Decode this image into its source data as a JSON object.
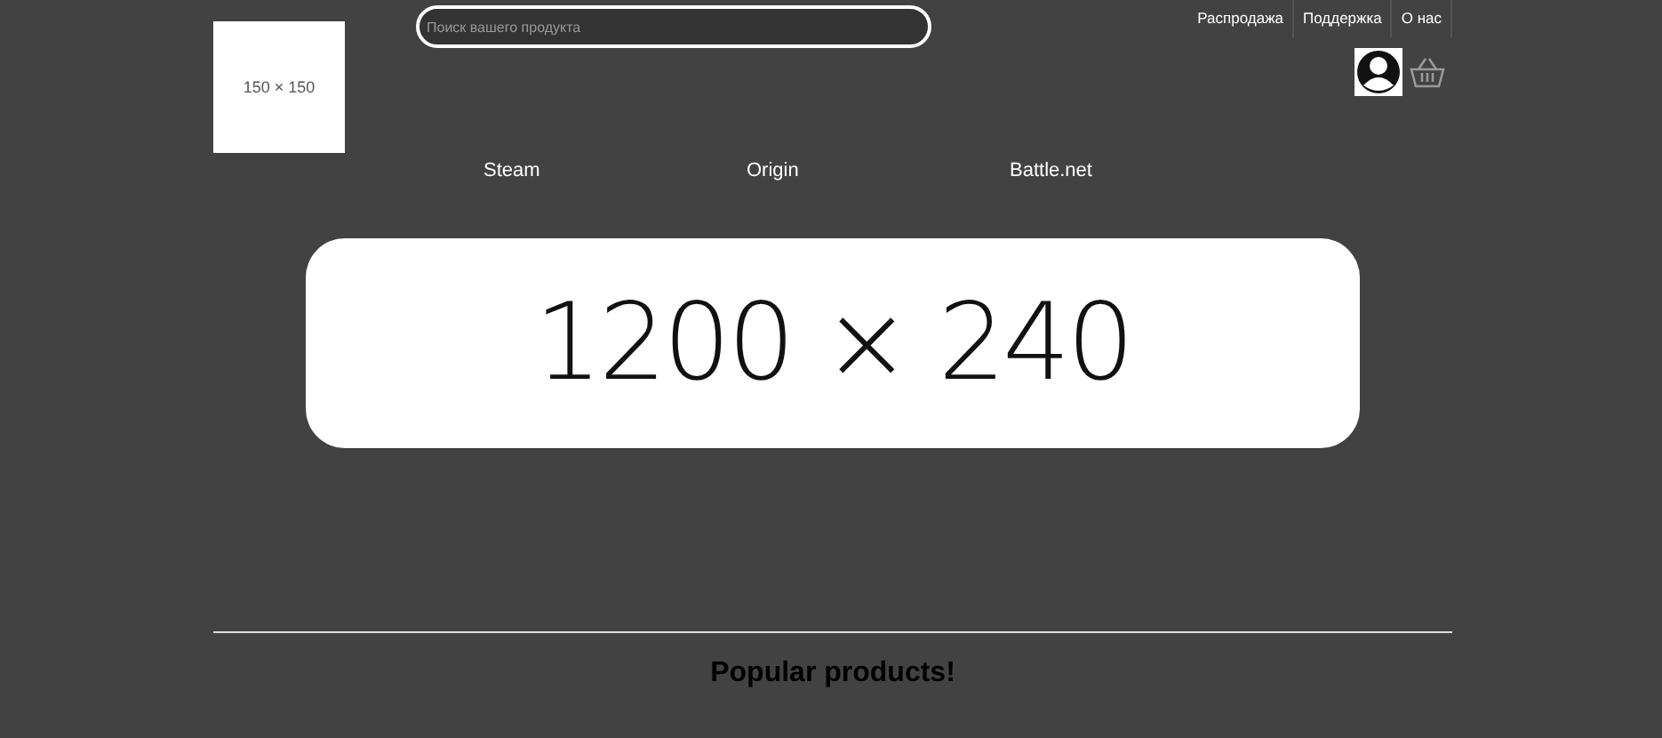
{
  "logo": {
    "text": "150 × 150"
  },
  "search": {
    "placeholder": "Поиск вашего продукта"
  },
  "top_links": [
    "Распродажа",
    "Поддержка",
    "О нас"
  ],
  "nav": [
    "Steam",
    "Origin",
    "Battle.net"
  ],
  "banner": {
    "text": "1200 × 240"
  },
  "section_title": "Popular products!"
}
